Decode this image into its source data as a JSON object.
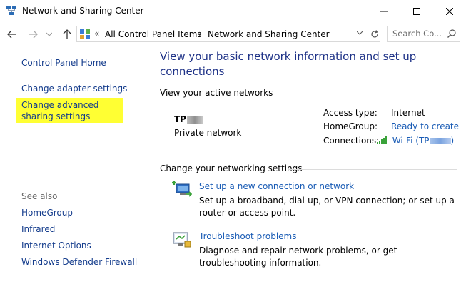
{
  "window": {
    "title": "Network and Sharing Center",
    "controls": {
      "minimize": "—",
      "maximize": "☐",
      "close": "✕"
    }
  },
  "address": {
    "overflow": "«",
    "crumbs": [
      "All Control Panel Items",
      "Network and Sharing Center"
    ],
    "separator": "›",
    "search_placeholder": "Search Co..."
  },
  "sidebar": {
    "home": "Control Panel Home",
    "items": [
      "Change adapter settings",
      "Change advanced sharing settings"
    ],
    "see_also_label": "See also",
    "see_also": [
      "HomeGroup",
      "Infrared",
      "Internet Options",
      "Windows Defender Firewall"
    ]
  },
  "main": {
    "heading": "View your basic network information and set up connections",
    "active_networks_label": "View your active networks",
    "network": {
      "name_prefix": "TP",
      "type": "Private network",
      "access_type_label": "Access type:",
      "access_type_value": "Internet",
      "homegroup_label": "HomeGroup:",
      "homegroup_value": "Ready to create",
      "connections_label": "Connections:",
      "connections_value": "Wi-Fi (TP",
      "connections_suffix": ")"
    },
    "change_settings_label": "Change your networking settings",
    "tasks": [
      {
        "title": "Set up a new connection or network",
        "description": "Set up a broadband, dial-up, or VPN connection; or set up a router or access point."
      },
      {
        "title": "Troubleshoot problems",
        "description": "Diagnose and repair network problems, or get troubleshooting information."
      }
    ]
  },
  "colors": {
    "link": "#1a5cb5",
    "heading": "#1e3287",
    "highlight": "#ffff33"
  },
  "icons": {
    "app": "network-sharing-icon",
    "back": "back-arrow-icon",
    "forward": "forward-arrow-icon",
    "up": "up-arrow-icon",
    "refresh": "refresh-icon",
    "search": "search-icon",
    "wifi": "wifi-signal-icon",
    "setup": "new-connection-icon",
    "troubleshoot": "troubleshoot-icon"
  }
}
